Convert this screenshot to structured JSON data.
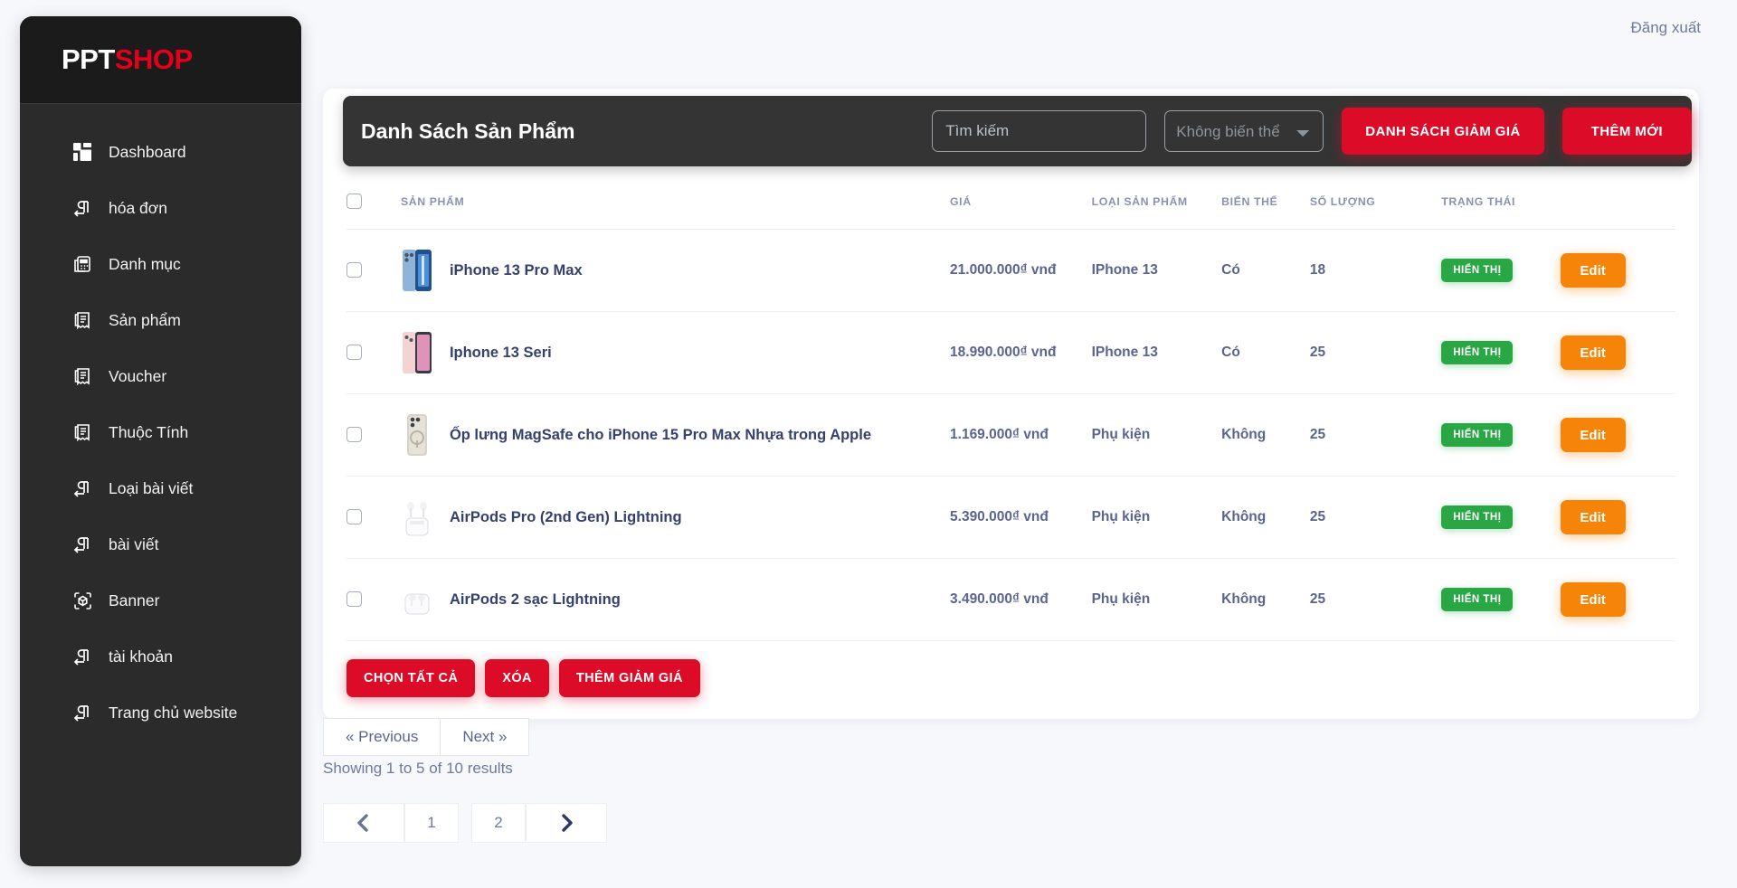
{
  "brand": {
    "part1": "PPT",
    "part2": "SHOP"
  },
  "sidebar": {
    "items": [
      {
        "label": "Dashboard",
        "icon": "dashboard-grid-icon"
      },
      {
        "label": "hóa đơn",
        "icon": "paragraph-icon"
      },
      {
        "label": "Danh mục",
        "icon": "calculator-icon"
      },
      {
        "label": "Sản phẩm",
        "icon": "receipt-icon"
      },
      {
        "label": "Voucher",
        "icon": "receipt-icon"
      },
      {
        "label": "Thuộc Tính",
        "icon": "receipt-icon"
      },
      {
        "label": "Loại bài viết",
        "icon": "paragraph-icon"
      },
      {
        "label": "bài viết",
        "icon": "paragraph-icon"
      },
      {
        "label": "Banner",
        "icon": "cube-scan-icon"
      },
      {
        "label": "tài khoản",
        "icon": "paragraph-icon"
      },
      {
        "label": "Trang chủ website",
        "icon": "paragraph-icon"
      }
    ]
  },
  "topbar": {
    "logout_label": "Đăng xuất"
  },
  "card": {
    "title": "Danh Sách Sản Phẩm",
    "search_placeholder": "Tìm kiếm",
    "search_value": "",
    "variant_selected": "Không biến thể",
    "variant_options": [
      "Không biến thể"
    ],
    "discount_list_label": "DANH SÁCH GIẢM GIÁ",
    "add_new_label": "THÊM MỚI"
  },
  "table": {
    "headers": [
      "SẢN PHẨM",
      "GIÁ",
      "LOẠI SẢN PHẨM",
      "BIẾN THỂ",
      "SỐ LƯỢNG",
      "TRẠNG THÁI"
    ],
    "rows": [
      {
        "name": "iPhone 13 Pro Max",
        "price": "21.000.000₫ vnđ",
        "type": "IPhone 13",
        "variant": "Có",
        "quantity": "18",
        "status": "HIỂN THỊ",
        "action": "Edit",
        "thumb": "iphone-13-pro-max-blue"
      },
      {
        "name": "Iphone 13 Seri",
        "price": "18.990.000₫ vnđ",
        "type": "IPhone 13",
        "variant": "Có",
        "quantity": "25",
        "status": "HIỂN THỊ",
        "action": "Edit",
        "thumb": "iphone-13-pink"
      },
      {
        "name": "Ốp lưng MagSafe cho iPhone 15 Pro Max Nhựa trong Apple",
        "price": "1.169.000₫ vnđ",
        "type": "Phụ kiện",
        "variant": "Không",
        "quantity": "25",
        "status": "HIỂN THỊ",
        "action": "Edit",
        "thumb": "magsafe-case"
      },
      {
        "name": "AirPods Pro (2nd Gen) Lightning",
        "price": "5.390.000₫ vnđ",
        "type": "Phụ kiện",
        "variant": "Không",
        "quantity": "25",
        "status": "HIỂN THỊ",
        "action": "Edit",
        "thumb": "airpods-pro"
      },
      {
        "name": "AirPods 2 sạc Lightning",
        "price": "3.490.000₫ vnđ",
        "type": "Phụ kiện",
        "variant": "Không",
        "quantity": "25",
        "status": "HIỂN THỊ",
        "action": "Edit",
        "thumb": "airpods-2"
      }
    ]
  },
  "bulk_actions": {
    "select_all": "CHỌN TẤT CẢ",
    "delete": "XÓA",
    "add_discount": "THÊM GIẢM GIÁ"
  },
  "pagination": {
    "previous": "« Previous",
    "next": "Next »",
    "results_text": "Showing 1 to 5 of 10 results",
    "pages": [
      "1",
      "2"
    ]
  },
  "colors": {
    "brand_red": "#e2001a",
    "button_red": "#dc0b28",
    "edit_orange": "#f68408",
    "status_green": "#29a745",
    "sidebar_dark": "#2b2b2b",
    "header_dark": "#343434"
  }
}
